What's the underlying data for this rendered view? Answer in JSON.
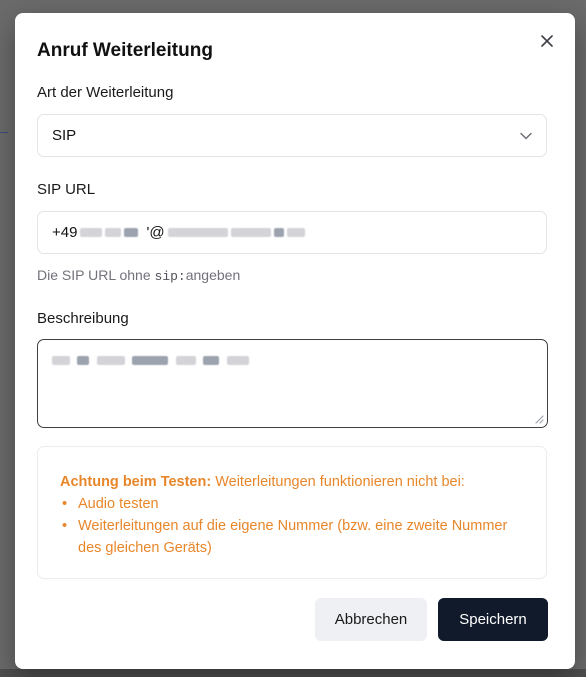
{
  "dialog": {
    "title": "Anruf Weiterleitung",
    "close_label": "×"
  },
  "forward_type": {
    "label": "Art der Weiterleitung",
    "selected": "SIP"
  },
  "sip_url": {
    "label": "SIP URL",
    "value_prefix": "+49",
    "value_at": "'@",
    "hint_before": "Die SIP URL ohne ",
    "hint_code": "sip:",
    "hint_after": "angeben"
  },
  "description": {
    "label": "Beschreibung"
  },
  "warning": {
    "heading": "Achtung beim Testen:",
    "text": " Weiterleitungen funktionieren nicht bei:",
    "items": [
      "Audio testen",
      "Weiterleitungen auf die eigene Nummer (bzw. eine zweite Nummer des gleichen Geräts)"
    ]
  },
  "actions": {
    "cancel": "Abbrechen",
    "save": "Speichern"
  },
  "colors": {
    "warning": "#e8862a",
    "primary": "#101a2b"
  }
}
